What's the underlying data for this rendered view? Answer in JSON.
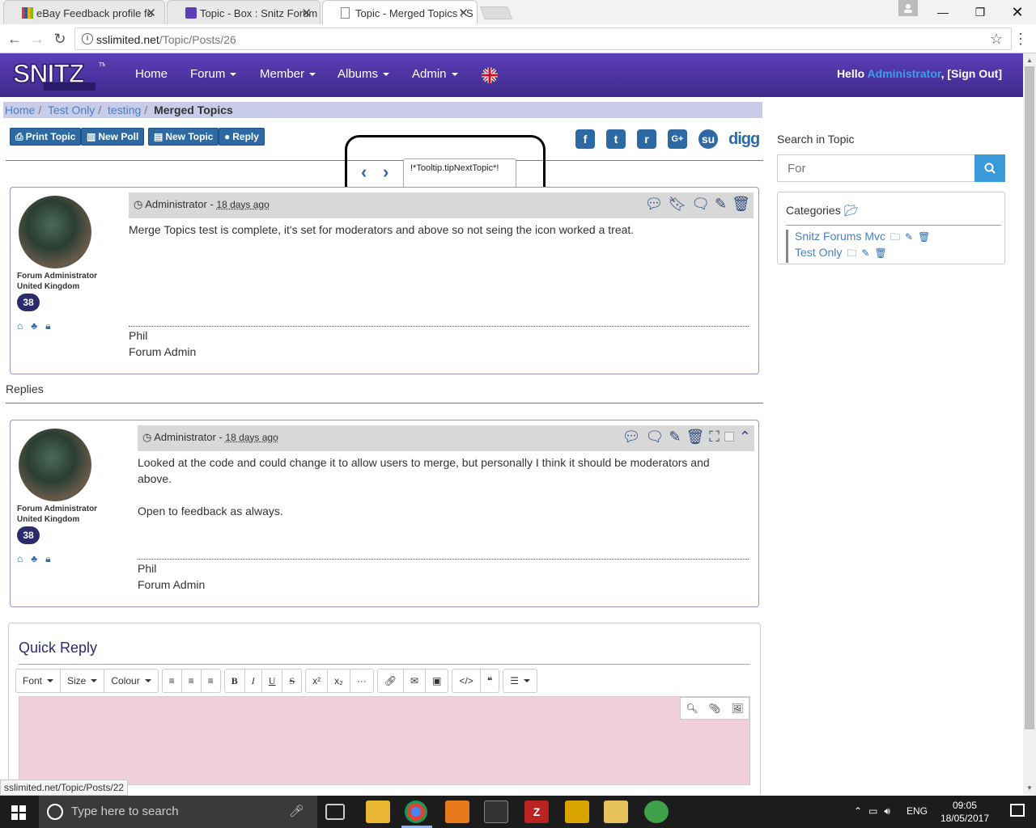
{
  "browser": {
    "tabs": [
      {
        "title": "eBay Feedback profile fo"
      },
      {
        "title": "Topic - Box : Snitz Forum"
      },
      {
        "title": "Topic - Merged Topics : S"
      }
    ],
    "url_host": "sslimited.net",
    "url_path": "/Topic/Posts/26",
    "status_url": "sslimited.net/Topic/Posts/22"
  },
  "header": {
    "logo": "SNITZ",
    "nav": [
      {
        "label": "Home",
        "dropdown": false
      },
      {
        "label": "Forum",
        "dropdown": true
      },
      {
        "label": "Member",
        "dropdown": true
      },
      {
        "label": "Albums",
        "dropdown": true
      },
      {
        "label": "Admin",
        "dropdown": true
      }
    ],
    "hello": "Hello",
    "username": "Administrator",
    "signout": ", [Sign Out]"
  },
  "breadcrumb": [
    "Home",
    "Test Only",
    "testing",
    "Merged Topics"
  ],
  "actions": {
    "print": "Print Topic",
    "newpoll": "New Poll",
    "newtopic": "New Topic",
    "reply": "Reply"
  },
  "tooltip": "!*Tooltip.tipNextTopic*!",
  "share": {
    "digg": "digg"
  },
  "posts": [
    {
      "author": "Administrator",
      "when": "18 days ago",
      "role": "Forum Administrator",
      "country": "United Kingdom",
      "count": "38",
      "body": "Merge Topics test is complete, it's set for moderators and above so not seing the icon worked a treat.",
      "sig1": "Phil",
      "sig2": "Forum Admin"
    },
    {
      "author": "Administrator",
      "when": "18 days ago",
      "role": "Forum Administrator",
      "country": "United Kingdom",
      "count": "38",
      "body1": "Looked at the code and could change it to allow users to merge, but personally I think it should be moderators and above.",
      "body2": "Open to feedback as always.",
      "sig1": "Phil",
      "sig2": "Forum Admin"
    }
  ],
  "replies_label": "Replies",
  "quickreply": {
    "title": "Quick Reply",
    "font": "Font",
    "size": "Size",
    "colour": "Colour"
  },
  "sidebar": {
    "search_label": "Search in Topic",
    "search_placeholder": "For",
    "categories_title": "Categories",
    "categories": [
      "Snitz Forums Mvc",
      "Test Only"
    ]
  },
  "taskbar": {
    "search_placeholder": "Type here to search",
    "lang": "ENG",
    "time": "09:05",
    "date": "18/05/2017"
  }
}
